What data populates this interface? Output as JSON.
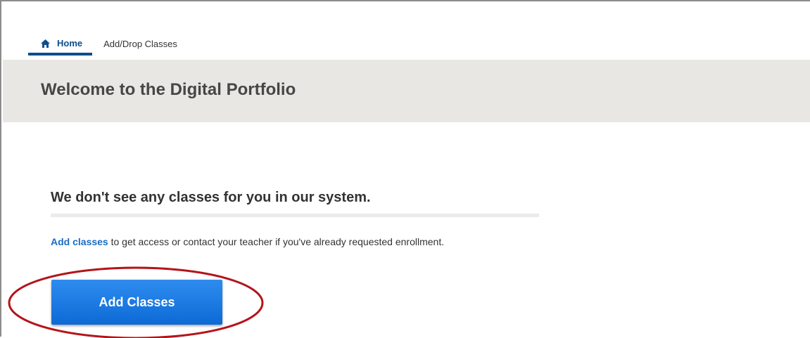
{
  "nav": {
    "tabs": [
      {
        "label": "Home",
        "active": true,
        "icon": "home-icon"
      },
      {
        "label": "Add/Drop Classes",
        "active": false
      }
    ]
  },
  "banner": {
    "title": "Welcome to the Digital Portfolio"
  },
  "empty_state": {
    "heading": "We don't see any classes for you in our system.",
    "link_text": "Add classes",
    "message_rest": " to get access or contact your teacher if you've already requested enrollment.",
    "button_label": "Add Classes"
  },
  "colors": {
    "nav_accent": "#0d4e8f",
    "banner_bg": "#e9e7e3",
    "link": "#1a6cc4",
    "button": "#1174e0",
    "annotation": "#b3151b"
  }
}
